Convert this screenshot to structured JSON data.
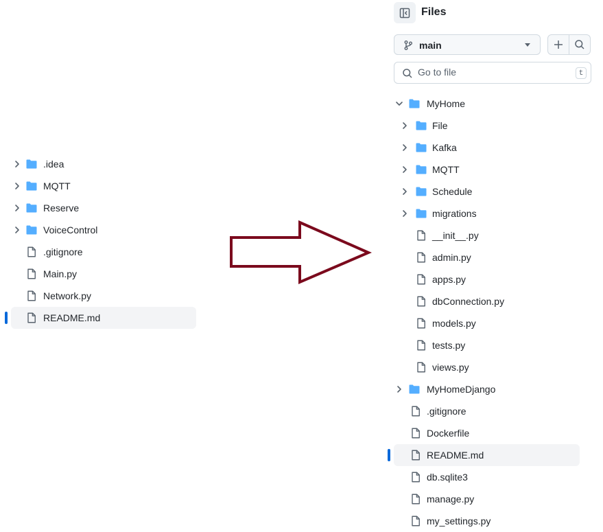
{
  "left_tree": {
    "items": [
      {
        "type": "folder",
        "name": ".idea",
        "icon": "folder-icon",
        "chevron": "chevron-right-icon"
      },
      {
        "type": "folder",
        "name": "MQTT",
        "icon": "folder-icon",
        "chevron": "chevron-right-icon"
      },
      {
        "type": "folder",
        "name": "Reserve",
        "icon": "folder-icon",
        "chevron": "chevron-right-icon"
      },
      {
        "type": "folder",
        "name": "VoiceControl",
        "icon": "folder-icon",
        "chevron": "chevron-right-icon"
      },
      {
        "type": "file",
        "name": ".gitignore",
        "icon": "file-icon"
      },
      {
        "type": "file",
        "name": "Main.py",
        "icon": "file-icon"
      },
      {
        "type": "file",
        "name": "Network.py",
        "icon": "file-icon"
      },
      {
        "type": "file",
        "name": "README.md",
        "icon": "file-icon",
        "selected": true
      }
    ]
  },
  "arrow": {
    "color": "#7b0a1d",
    "icon": "right-arrow-icon"
  },
  "right_panel": {
    "title": "Files",
    "sidebar_toggle_icon": "sidebar-collapse-icon",
    "branch": {
      "label": "main",
      "icon": "git-branch-icon",
      "caret": "triangle-down-icon"
    },
    "add_icon": "plus-icon",
    "search_icon": "search-icon",
    "search": {
      "placeholder": "Go to file",
      "shortcut": "t"
    },
    "tree": {
      "items": [
        {
          "type": "folder",
          "name": "MyHome",
          "expanded": true,
          "depth": 0
        },
        {
          "type": "folder",
          "name": "File",
          "depth": 1
        },
        {
          "type": "folder",
          "name": "Kafka",
          "depth": 1
        },
        {
          "type": "folder",
          "name": "MQTT",
          "depth": 1
        },
        {
          "type": "folder",
          "name": "Schedule",
          "depth": 1
        },
        {
          "type": "folder",
          "name": "migrations",
          "depth": 1
        },
        {
          "type": "file",
          "name": "__init__.py",
          "depth": 1
        },
        {
          "type": "file",
          "name": "admin.py",
          "depth": 1
        },
        {
          "type": "file",
          "name": "apps.py",
          "depth": 1
        },
        {
          "type": "file",
          "name": "dbConnection.py",
          "depth": 1
        },
        {
          "type": "file",
          "name": "models.py",
          "depth": 1
        },
        {
          "type": "file",
          "name": "tests.py",
          "depth": 1
        },
        {
          "type": "file",
          "name": "views.py",
          "depth": 1
        },
        {
          "type": "folder",
          "name": "MyHomeDjango",
          "depth": 0
        },
        {
          "type": "file",
          "name": ".gitignore",
          "depth": 0
        },
        {
          "type": "file",
          "name": "Dockerfile",
          "depth": 0
        },
        {
          "type": "file",
          "name": "README.md",
          "depth": 0,
          "selected": true
        },
        {
          "type": "file",
          "name": "db.sqlite3",
          "depth": 0
        },
        {
          "type": "file",
          "name": "manage.py",
          "depth": 0
        },
        {
          "type": "file",
          "name": "my_settings.py",
          "depth": 0
        }
      ]
    }
  },
  "colors": {
    "folder": "#54aeff",
    "selected_bar": "#0969da",
    "icon_gray": "#59636e"
  }
}
